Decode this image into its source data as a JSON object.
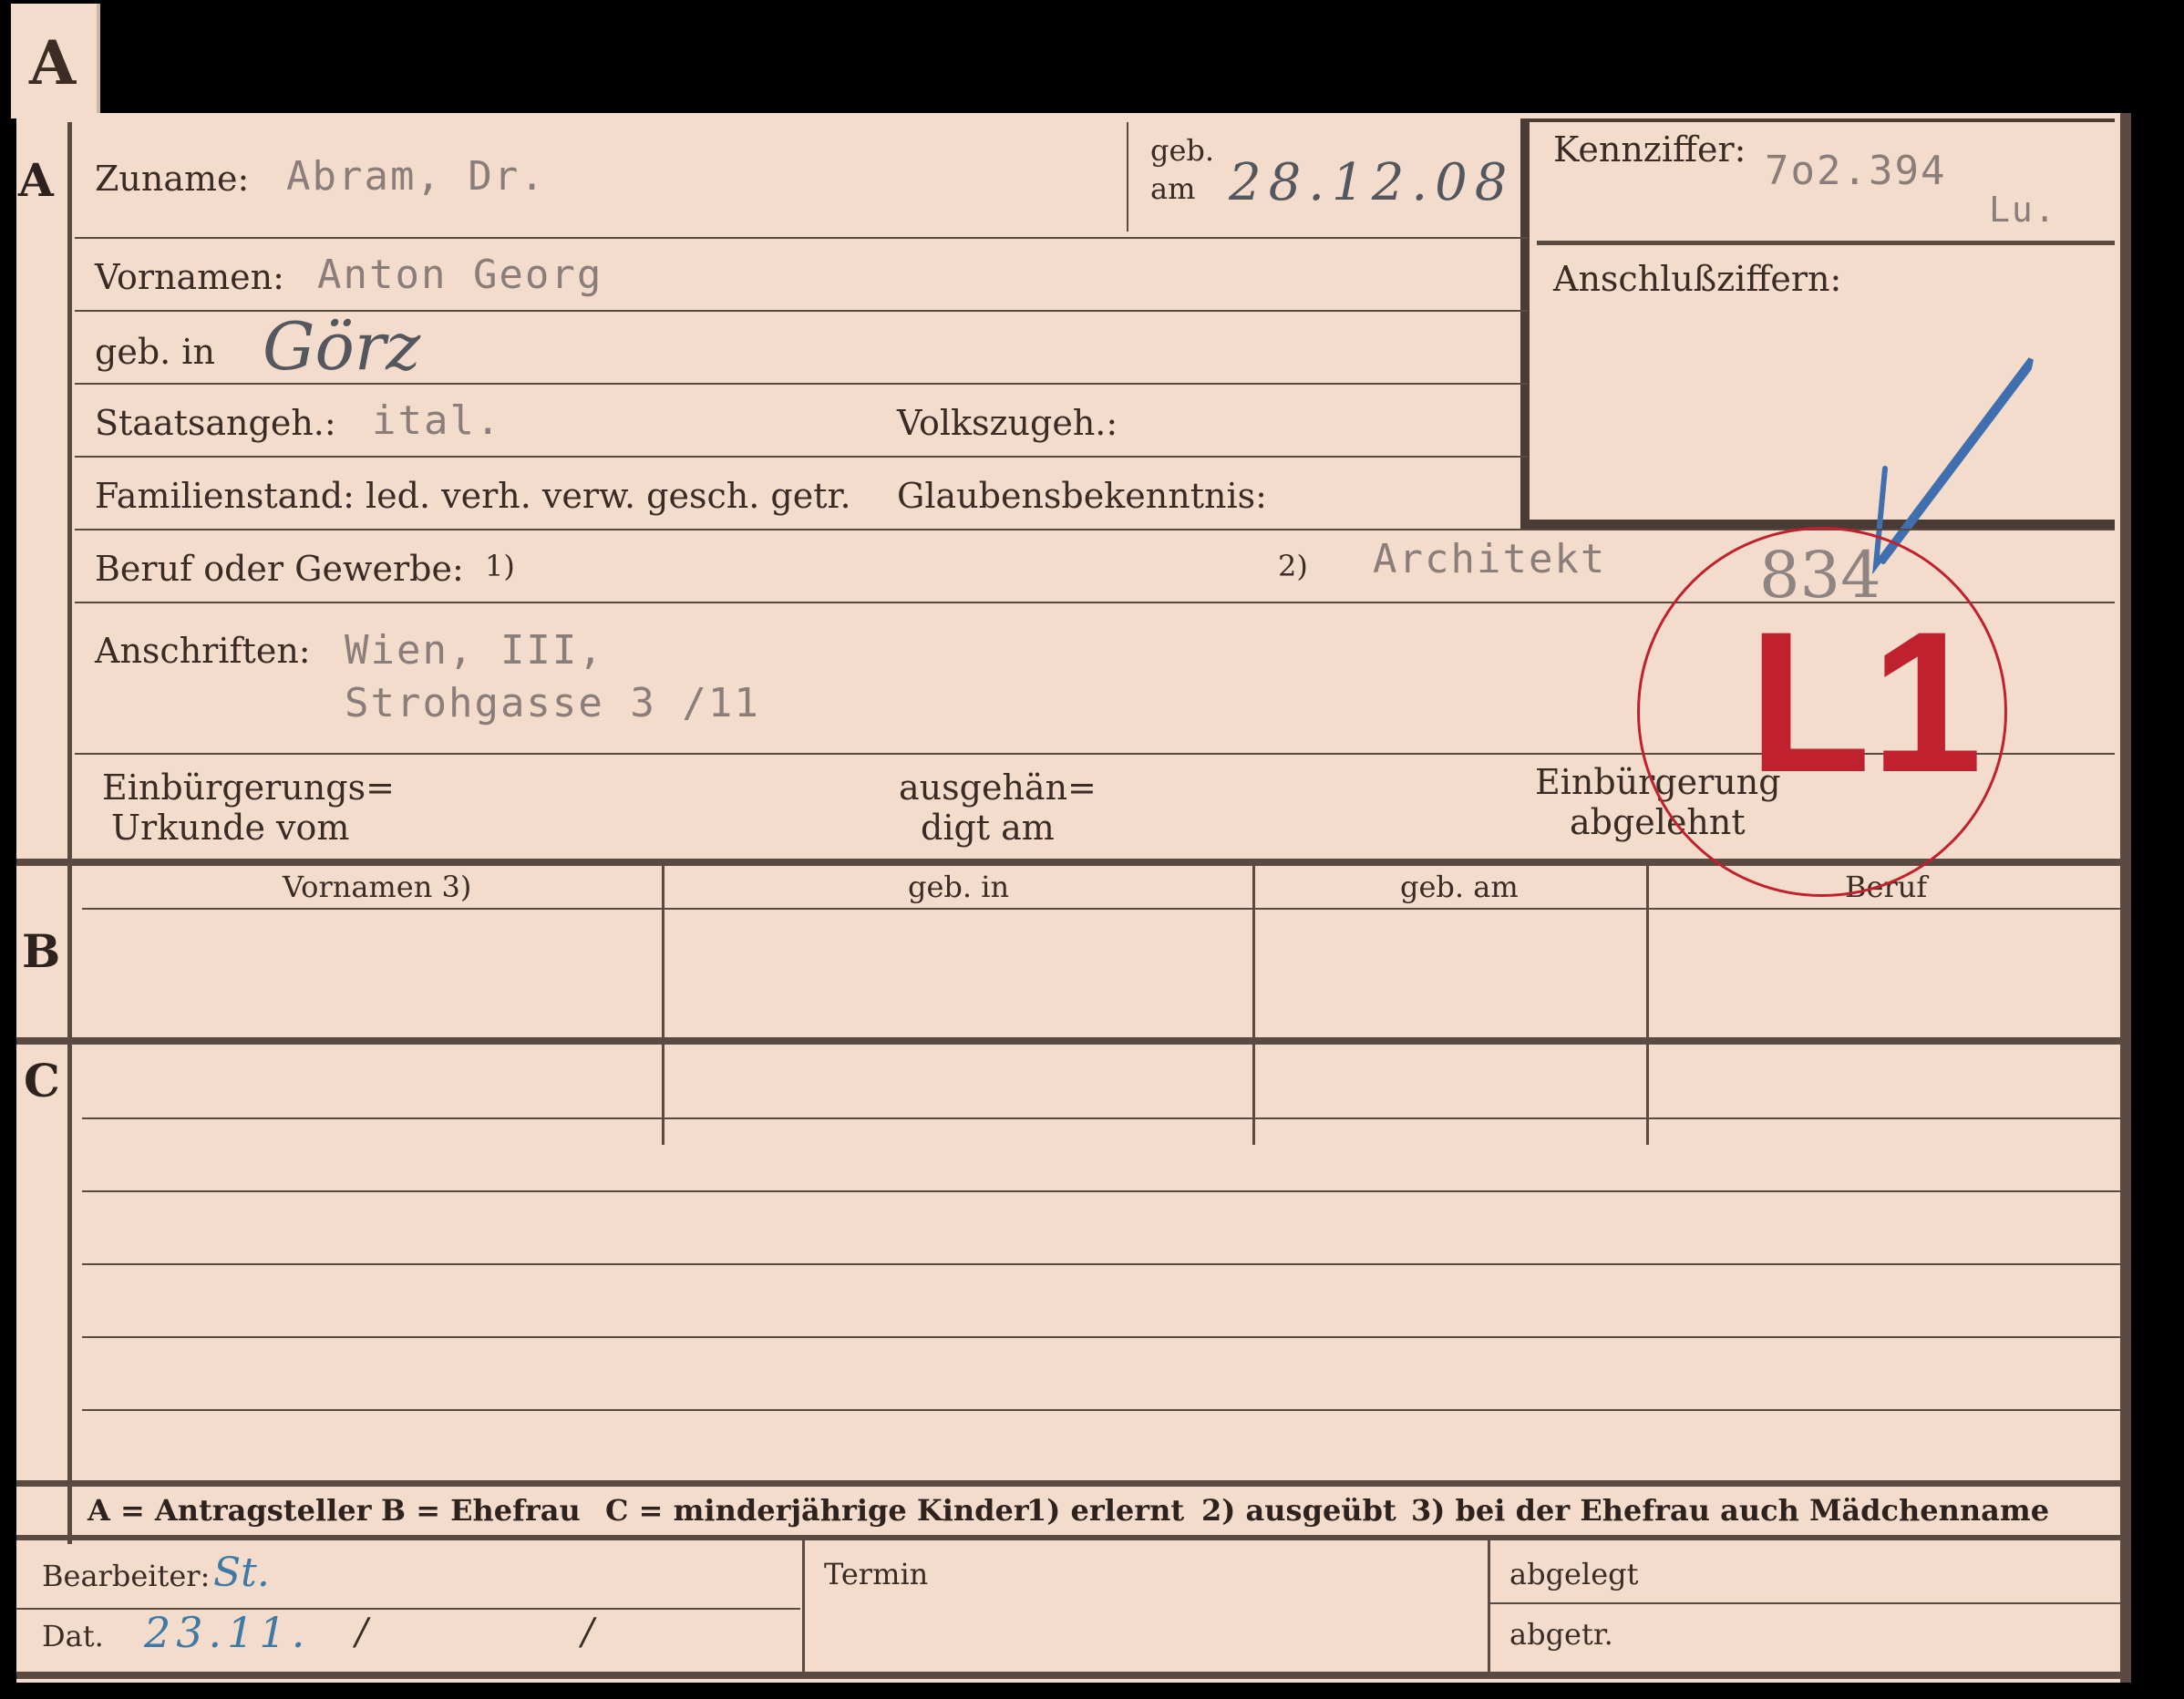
{
  "tab_letter": "A",
  "section_a": {
    "letter": "A",
    "zuname_label": "Zuname:",
    "zuname_value": "Abram, Dr.",
    "geb_am_label_1": "geb.",
    "geb_am_label_2": "am",
    "geb_am_value": "28.12.08",
    "kennziffer_label": "Kennziffer:",
    "kennziffer_value": "7o2.394",
    "kennziffer_suffix": "Lu.",
    "anschluss_label": "Anschlußziffern:",
    "vornamen_label": "Vornamen:",
    "vornamen_value": "Anton Georg",
    "geb_in_label": "geb. in",
    "geb_in_value": "Görz",
    "staat_label": "Staatsangeh.:",
    "staat_value": "ital.",
    "volks_label": "Volkszugeh.:",
    "familien_label": "Familienstand: led. verh. verw. gesch. getr.",
    "glauben_label": "Glaubensbekenntnis:",
    "beruf_label": "Beruf oder Gewerbe:",
    "beruf_note1": "1)",
    "beruf_note2": "2)",
    "beruf_value": "Architekt",
    "anschrift_label": "Anschriften:",
    "anschrift_line1": "Wien, III,",
    "anschrift_line2": "Strohgasse 3 /11",
    "einb_urk_1": "Einbürgerungs=",
    "einb_urk_2": "Urkunde vom",
    "ausgeh_1": "ausgehän=",
    "ausgeh_2": "digt am",
    "einb_abg_1": "Einbürgerung",
    "einb_abg_2": "abgelehnt"
  },
  "stamp": {
    "number": "834",
    "code": "L1"
  },
  "section_b": {
    "letter": "B",
    "headers": [
      "Vornamen 3)",
      "geb. in",
      "geb. am",
      "Beruf"
    ]
  },
  "section_c": {
    "letter": "C"
  },
  "legend": {
    "a": "A = Antragsteller",
    "b": "B = Ehefrau",
    "c": "C = minderjährige Kinder",
    "n1": "1) erlernt",
    "n2": "2) ausgeübt",
    "n3": "3) bei der Ehefrau auch Mädchenname"
  },
  "footer": {
    "bearbeiter_label": "Bearbeiter:",
    "bearbeiter_value": "St.",
    "dat_label": "Dat.",
    "dat_value": "23.11.",
    "slash1": "/",
    "slash2": "/",
    "termin_label": "Termin",
    "abgelegt_label": "abgelegt",
    "abgetr_label": "abgetr."
  },
  "colors": {
    "paper": "#f3dccc",
    "ink": "#3a2b25",
    "stamp_red": "#c0212e",
    "check_blue": "#3f6fae"
  }
}
